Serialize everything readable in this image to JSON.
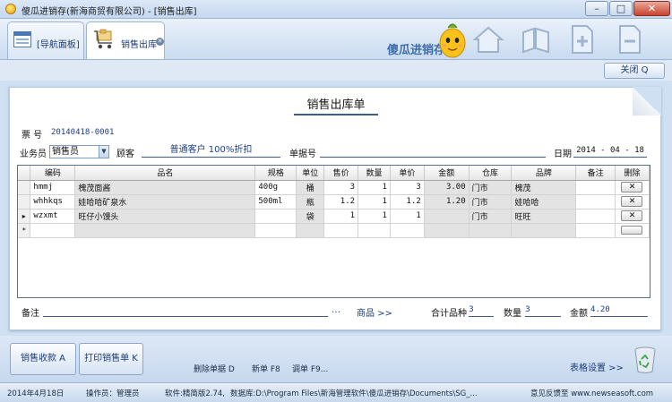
{
  "window": {
    "title": "傻瓜进销存(新海商贸有限公司) - [销售出库]",
    "min": "–",
    "max": "□",
    "close": "✕"
  },
  "tabs": [
    {
      "label": "[导航面板]"
    },
    {
      "label": "销售出库",
      "close": "✕"
    }
  ],
  "brand": {
    "text": "傻瓜进销存"
  },
  "toolbar_icons": [
    "home-icon",
    "copy-docs-icon",
    "add-page-icon",
    "remove-page-icon"
  ],
  "actions": {
    "close_label": "关闭 Q"
  },
  "form": {
    "title": "销售出库单",
    "ticket_label": "票  号",
    "ticket_no": "20140418-0001",
    "salesperson_label": "业务员",
    "salesperson": "销售员",
    "customer_label": "顾客",
    "customer": "普通客户 100%折扣",
    "docno_label": "单据号",
    "docno": "",
    "date_label": "日期",
    "date": "2014 - 04 - 18"
  },
  "grid": {
    "columns": [
      "编码",
      "品名",
      "规格",
      "单位",
      "售价",
      "数量",
      "单价",
      "金额",
      "仓库",
      "品牌",
      "备注",
      "删除"
    ],
    "rows": [
      {
        "marker": "",
        "code": "hmmj",
        "name": "槐茂面酱",
        "spec": "400g",
        "unit": "桶",
        "price": "3",
        "qty": "1",
        "unit_price": "3",
        "amount": "3.00",
        "warehouse": "门市",
        "brand": "槐茂",
        "note": "",
        "del": "✕"
      },
      {
        "marker": "",
        "code": "whhkqs",
        "name": "娃哈哈矿泉水",
        "spec": "500ml",
        "unit": "瓶",
        "price": "1.2",
        "qty": "1",
        "unit_price": "1.2",
        "amount": "1.20",
        "warehouse": "门市",
        "brand": "娃哈哈",
        "note": "",
        "del": "✕"
      },
      {
        "marker": "▸",
        "code": "wzxmt",
        "name": "旺仔小馒头",
        "spec": "",
        "unit": "袋",
        "price": "1",
        "qty": "1",
        "unit_price": "1",
        "amount": "",
        "warehouse": "门市",
        "brand": "旺旺",
        "note": "",
        "del": "✕"
      },
      {
        "marker": "*",
        "code": "",
        "name": "",
        "spec": "",
        "unit": "",
        "price": "",
        "qty": "",
        "unit_price": "",
        "amount": "",
        "warehouse": "",
        "brand": "",
        "note": "",
        "del": ""
      }
    ]
  },
  "summary": {
    "remark_label": "备注",
    "more": "…",
    "goods_link": "商品 >>",
    "items_label": "合计品种",
    "items": "3",
    "qty_label": "数量",
    "qty": "3",
    "amount_label": "金额",
    "amount": "4.20"
  },
  "bottom": {
    "checkout": "销售收款 A",
    "print": "打印销售单 K",
    "delete_doc": "删除单据 D",
    "new_doc": "新单 F8",
    "fetch_doc": "调单 F9...",
    "table_settings": "表格设置 >>"
  },
  "status": {
    "date": "2014年4月18日",
    "operator": "操作员：管理员",
    "version": "软件:精简版2.74,",
    "database": "数据库:D:\\Program Files\\新海管理软件\\傻瓜进销存\\Documents\\SG_...",
    "feedback": "意见反馈至 www.newseasoft.com"
  },
  "colors": {
    "accent": "#1d3c78",
    "window_bg": "#cfe0f3",
    "readonly_cell": "#e3e3e3"
  }
}
